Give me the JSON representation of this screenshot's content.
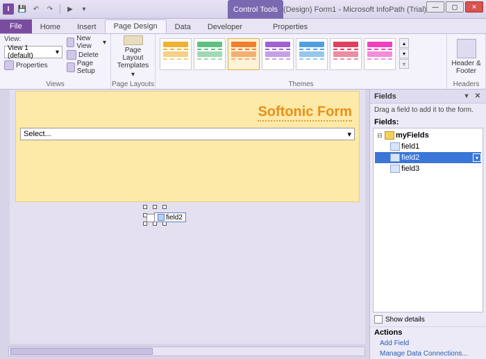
{
  "titlebar": {
    "app_icon": "I",
    "control_tools": "Control Tools",
    "title": "(Design) Form1 - Microsoft InfoPath (Trial)"
  },
  "tabs": {
    "file": "File",
    "home": "Home",
    "insert": "Insert",
    "page_design": "Page Design",
    "data": "Data",
    "developer": "Developer",
    "properties": "Properties"
  },
  "ribbon": {
    "views": {
      "label": "Views",
      "view_caption": "View:",
      "view_combo": "View 1 (default)",
      "new_view": "New View",
      "delete": "Delete",
      "properties": "Properties",
      "page_setup": "Page Setup"
    },
    "page_layouts": {
      "label": "Page Layouts",
      "btn": "Page Layout Templates"
    },
    "themes": {
      "label": "Themes"
    },
    "headers": {
      "label": "Headers",
      "btn": "Header & Footer"
    }
  },
  "form": {
    "title": "Softonic Form",
    "select_placeholder": "Select...",
    "dragged_field": "field2"
  },
  "fields_pane": {
    "header": "Fields",
    "hint": "Drag a field to add it to the form.",
    "fields_label": "Fields:",
    "root": "myFields",
    "items": [
      "field1",
      "field2",
      "field3"
    ],
    "show_details": "Show details",
    "actions_label": "Actions",
    "add_field": "Add Field",
    "manage": "Manage Data Connections..."
  },
  "theme_colors": [
    "#f0b030",
    "#60c080",
    "#f08030",
    "#a060d0",
    "#50a0e0",
    "#e04060",
    "#f040c0"
  ]
}
